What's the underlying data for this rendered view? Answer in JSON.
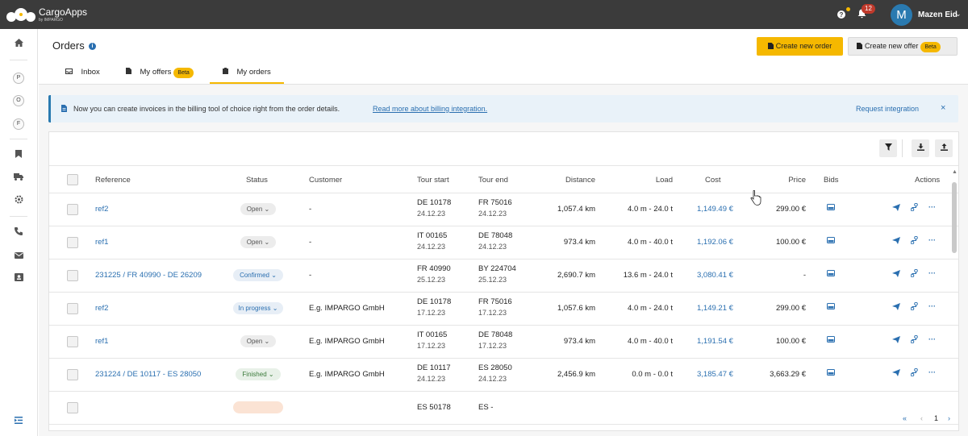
{
  "topbar": {
    "brand": "CargoApps",
    "brand_sub": "by IMPARGO",
    "notification_count": "12",
    "user_initial": "M",
    "user_name": "Mazen Eid"
  },
  "sidebar": {
    "items": [
      "home-icon",
      "P",
      "O",
      "F",
      "bookmark-icon",
      "truck-icon",
      "gear-icon",
      "phone-icon",
      "mail-icon",
      "contact-card-icon",
      "collapse-icon"
    ]
  },
  "header": {
    "title": "Orders",
    "create_order_label": "Create new order",
    "create_offer_label": "Create new offer",
    "beta_label": "Beta"
  },
  "tabs": [
    {
      "label": "Inbox"
    },
    {
      "label": "My offers",
      "badge": "Beta"
    },
    {
      "label": "My orders",
      "active": true
    }
  ],
  "notice": {
    "text": "Now you can create invoices in the billing tool of choice right from the order details.",
    "link": "Read more about billing integration.",
    "action": "Request integration"
  },
  "table": {
    "columns": [
      "Reference",
      "Status",
      "Customer",
      "Tour start",
      "Tour end",
      "Distance",
      "Load",
      "Cost",
      "Price",
      "Bids",
      "Actions"
    ],
    "rows": [
      {
        "reference": "ref2",
        "status": "Open",
        "status_kind": "open",
        "customer": "-",
        "start": "DE 10178",
        "start_date": "24.12.23",
        "end": "FR 75016",
        "end_date": "24.12.23",
        "distance": "1,057.4 km",
        "load": "4.0 m - 24.0 t",
        "cost": "1,149.49 €",
        "price": "299.00 €"
      },
      {
        "reference": "ref1",
        "status": "Open",
        "status_kind": "open",
        "customer": "-",
        "start": "IT 00165",
        "start_date": "24.12.23",
        "end": "DE 78048",
        "end_date": "24.12.23",
        "distance": "973.4 km",
        "load": "4.0 m - 40.0 t",
        "cost": "1,192.06 €",
        "price": "100.00 €"
      },
      {
        "reference": "231225 / FR 40990 - DE 26209",
        "status": "Confirmed",
        "status_kind": "confirmed",
        "customer": "-",
        "start": "FR 40990",
        "start_date": "25.12.23",
        "end": "BY 224704",
        "end_date": "25.12.23",
        "distance": "2,690.7 km",
        "load": "13.6 m - 24.0 t",
        "cost": "3,080.41 €",
        "price": "-"
      },
      {
        "reference": "ref2",
        "status": "In progress",
        "status_kind": "progress",
        "customer": "E.g. IMPARGO GmbH",
        "start": "DE 10178",
        "start_date": "17.12.23",
        "end": "FR 75016",
        "end_date": "17.12.23",
        "distance": "1,057.6 km",
        "load": "4.0 m - 24.0 t",
        "cost": "1,149.21 €",
        "price": "299.00 €"
      },
      {
        "reference": "ref1",
        "status": "Open",
        "status_kind": "open",
        "customer": "E.g. IMPARGO GmbH",
        "start": "IT 00165",
        "start_date": "17.12.23",
        "end": "DE 78048",
        "end_date": "17.12.23",
        "distance": "973.4 km",
        "load": "4.0 m - 40.0 t",
        "cost": "1,191.54 €",
        "price": "100.00 €"
      },
      {
        "reference": "231224 / DE 10117 - ES 28050",
        "status": "Finished",
        "status_kind": "finished",
        "customer": "E.g. IMPARGO GmbH",
        "start": "DE 10117",
        "start_date": "24.12.23",
        "end": "ES 28050",
        "end_date": "24.12.23",
        "distance": "2,456.9 km",
        "load": "0.0 m - 0.0 t",
        "cost": "3,185.47 €",
        "price": "3,663.29 €"
      },
      {
        "reference": "",
        "status": "",
        "status_kind": "partial",
        "customer": "",
        "start": "ES 50178",
        "start_date": "",
        "end": "ES -",
        "end_date": "",
        "distance": "",
        "load": "",
        "cost": "",
        "price": ""
      }
    ]
  },
  "pagination": {
    "page": "1"
  }
}
